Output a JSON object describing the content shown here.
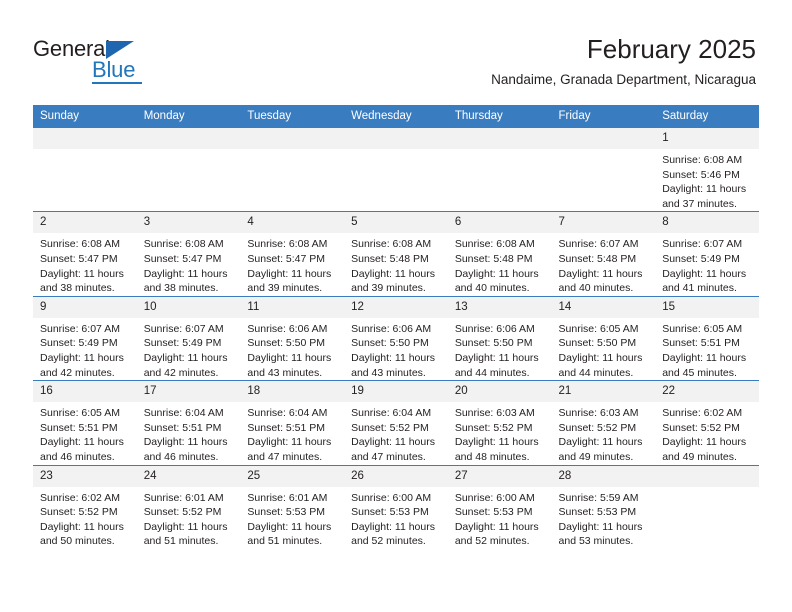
{
  "brand": {
    "name_part1": "General",
    "name_part2": "Blue",
    "triangle_icon": "triangle-icon",
    "accent_color": "#2276bc"
  },
  "header": {
    "title": "February 2025",
    "subtitle": "Nandaime, Granada Department, Nicaragua"
  },
  "theme": {
    "header_bg": "#3a7cc0",
    "daynum_bg": "#f2f2f2",
    "text_color": "#231f20"
  },
  "calendar": {
    "weekday_headers": [
      "Sunday",
      "Monday",
      "Tuesday",
      "Wednesday",
      "Thursday",
      "Friday",
      "Saturday"
    ],
    "weeks": [
      [
        {
          "day": "",
          "empty": true,
          "sunrise": "",
          "sunset": "",
          "daylight1": "",
          "daylight2": ""
        },
        {
          "day": "",
          "empty": true,
          "sunrise": "",
          "sunset": "",
          "daylight1": "",
          "daylight2": ""
        },
        {
          "day": "",
          "empty": true,
          "sunrise": "",
          "sunset": "",
          "daylight1": "",
          "daylight2": ""
        },
        {
          "day": "",
          "empty": true,
          "sunrise": "",
          "sunset": "",
          "daylight1": "",
          "daylight2": ""
        },
        {
          "day": "",
          "empty": true,
          "sunrise": "",
          "sunset": "",
          "daylight1": "",
          "daylight2": ""
        },
        {
          "day": "",
          "empty": true,
          "sunrise": "",
          "sunset": "",
          "daylight1": "",
          "daylight2": ""
        },
        {
          "day": "1",
          "empty": false,
          "sunrise": "Sunrise: 6:08 AM",
          "sunset": "Sunset: 5:46 PM",
          "daylight1": "Daylight: 11 hours",
          "daylight2": "and 37 minutes."
        }
      ],
      [
        {
          "day": "2",
          "empty": false,
          "sunrise": "Sunrise: 6:08 AM",
          "sunset": "Sunset: 5:47 PM",
          "daylight1": "Daylight: 11 hours",
          "daylight2": "and 38 minutes."
        },
        {
          "day": "3",
          "empty": false,
          "sunrise": "Sunrise: 6:08 AM",
          "sunset": "Sunset: 5:47 PM",
          "daylight1": "Daylight: 11 hours",
          "daylight2": "and 38 minutes."
        },
        {
          "day": "4",
          "empty": false,
          "sunrise": "Sunrise: 6:08 AM",
          "sunset": "Sunset: 5:47 PM",
          "daylight1": "Daylight: 11 hours",
          "daylight2": "and 39 minutes."
        },
        {
          "day": "5",
          "empty": false,
          "sunrise": "Sunrise: 6:08 AM",
          "sunset": "Sunset: 5:48 PM",
          "daylight1": "Daylight: 11 hours",
          "daylight2": "and 39 minutes."
        },
        {
          "day": "6",
          "empty": false,
          "sunrise": "Sunrise: 6:08 AM",
          "sunset": "Sunset: 5:48 PM",
          "daylight1": "Daylight: 11 hours",
          "daylight2": "and 40 minutes."
        },
        {
          "day": "7",
          "empty": false,
          "sunrise": "Sunrise: 6:07 AM",
          "sunset": "Sunset: 5:48 PM",
          "daylight1": "Daylight: 11 hours",
          "daylight2": "and 40 minutes."
        },
        {
          "day": "8",
          "empty": false,
          "sunrise": "Sunrise: 6:07 AM",
          "sunset": "Sunset: 5:49 PM",
          "daylight1": "Daylight: 11 hours",
          "daylight2": "and 41 minutes."
        }
      ],
      [
        {
          "day": "9",
          "empty": false,
          "sunrise": "Sunrise: 6:07 AM",
          "sunset": "Sunset: 5:49 PM",
          "daylight1": "Daylight: 11 hours",
          "daylight2": "and 42 minutes."
        },
        {
          "day": "10",
          "empty": false,
          "sunrise": "Sunrise: 6:07 AM",
          "sunset": "Sunset: 5:49 PM",
          "daylight1": "Daylight: 11 hours",
          "daylight2": "and 42 minutes."
        },
        {
          "day": "11",
          "empty": false,
          "sunrise": "Sunrise: 6:06 AM",
          "sunset": "Sunset: 5:50 PM",
          "daylight1": "Daylight: 11 hours",
          "daylight2": "and 43 minutes."
        },
        {
          "day": "12",
          "empty": false,
          "sunrise": "Sunrise: 6:06 AM",
          "sunset": "Sunset: 5:50 PM",
          "daylight1": "Daylight: 11 hours",
          "daylight2": "and 43 minutes."
        },
        {
          "day": "13",
          "empty": false,
          "sunrise": "Sunrise: 6:06 AM",
          "sunset": "Sunset: 5:50 PM",
          "daylight1": "Daylight: 11 hours",
          "daylight2": "and 44 minutes."
        },
        {
          "day": "14",
          "empty": false,
          "sunrise": "Sunrise: 6:05 AM",
          "sunset": "Sunset: 5:50 PM",
          "daylight1": "Daylight: 11 hours",
          "daylight2": "and 44 minutes."
        },
        {
          "day": "15",
          "empty": false,
          "sunrise": "Sunrise: 6:05 AM",
          "sunset": "Sunset: 5:51 PM",
          "daylight1": "Daylight: 11 hours",
          "daylight2": "and 45 minutes."
        }
      ],
      [
        {
          "day": "16",
          "empty": false,
          "sunrise": "Sunrise: 6:05 AM",
          "sunset": "Sunset: 5:51 PM",
          "daylight1": "Daylight: 11 hours",
          "daylight2": "and 46 minutes."
        },
        {
          "day": "17",
          "empty": false,
          "sunrise": "Sunrise: 6:04 AM",
          "sunset": "Sunset: 5:51 PM",
          "daylight1": "Daylight: 11 hours",
          "daylight2": "and 46 minutes."
        },
        {
          "day": "18",
          "empty": false,
          "sunrise": "Sunrise: 6:04 AM",
          "sunset": "Sunset: 5:51 PM",
          "daylight1": "Daylight: 11 hours",
          "daylight2": "and 47 minutes."
        },
        {
          "day": "19",
          "empty": false,
          "sunrise": "Sunrise: 6:04 AM",
          "sunset": "Sunset: 5:52 PM",
          "daylight1": "Daylight: 11 hours",
          "daylight2": "and 47 minutes."
        },
        {
          "day": "20",
          "empty": false,
          "sunrise": "Sunrise: 6:03 AM",
          "sunset": "Sunset: 5:52 PM",
          "daylight1": "Daylight: 11 hours",
          "daylight2": "and 48 minutes."
        },
        {
          "day": "21",
          "empty": false,
          "sunrise": "Sunrise: 6:03 AM",
          "sunset": "Sunset: 5:52 PM",
          "daylight1": "Daylight: 11 hours",
          "daylight2": "and 49 minutes."
        },
        {
          "day": "22",
          "empty": false,
          "sunrise": "Sunrise: 6:02 AM",
          "sunset": "Sunset: 5:52 PM",
          "daylight1": "Daylight: 11 hours",
          "daylight2": "and 49 minutes."
        }
      ],
      [
        {
          "day": "23",
          "empty": false,
          "sunrise": "Sunrise: 6:02 AM",
          "sunset": "Sunset: 5:52 PM",
          "daylight1": "Daylight: 11 hours",
          "daylight2": "and 50 minutes."
        },
        {
          "day": "24",
          "empty": false,
          "sunrise": "Sunrise: 6:01 AM",
          "sunset": "Sunset: 5:52 PM",
          "daylight1": "Daylight: 11 hours",
          "daylight2": "and 51 minutes."
        },
        {
          "day": "25",
          "empty": false,
          "sunrise": "Sunrise: 6:01 AM",
          "sunset": "Sunset: 5:53 PM",
          "daylight1": "Daylight: 11 hours",
          "daylight2": "and 51 minutes."
        },
        {
          "day": "26",
          "empty": false,
          "sunrise": "Sunrise: 6:00 AM",
          "sunset": "Sunset: 5:53 PM",
          "daylight1": "Daylight: 11 hours",
          "daylight2": "and 52 minutes."
        },
        {
          "day": "27",
          "empty": false,
          "sunrise": "Sunrise: 6:00 AM",
          "sunset": "Sunset: 5:53 PM",
          "daylight1": "Daylight: 11 hours",
          "daylight2": "and 52 minutes."
        },
        {
          "day": "28",
          "empty": false,
          "sunrise": "Sunrise: 5:59 AM",
          "sunset": "Sunset: 5:53 PM",
          "daylight1": "Daylight: 11 hours",
          "daylight2": "and 53 minutes."
        },
        {
          "day": "",
          "empty": true,
          "sunrise": "",
          "sunset": "",
          "daylight1": "",
          "daylight2": ""
        }
      ]
    ]
  }
}
